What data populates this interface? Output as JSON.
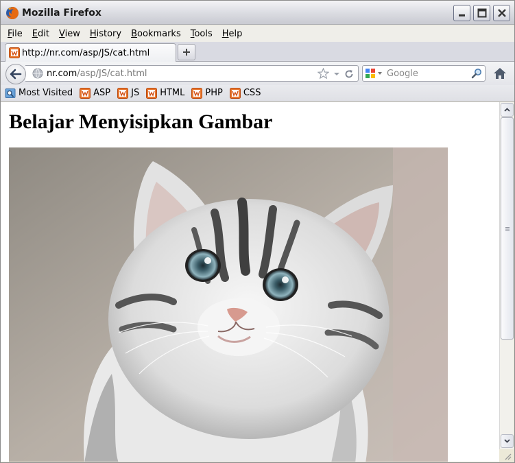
{
  "window": {
    "title": "Mozilla Firefox"
  },
  "menu": {
    "items": [
      {
        "label": "File",
        "key": "F",
        "rest": "ile"
      },
      {
        "label": "Edit",
        "key": "E",
        "rest": "dit"
      },
      {
        "label": "View",
        "key": "V",
        "rest": "iew"
      },
      {
        "label": "History",
        "key": "H",
        "rest": "istory"
      },
      {
        "label": "Bookmarks",
        "key": "B",
        "rest": "ookmarks"
      },
      {
        "label": "Tools",
        "key": "T",
        "rest": "ools"
      },
      {
        "label": "Help",
        "key": "H",
        "rest": "elp"
      }
    ]
  },
  "tab": {
    "label": "http://nr.com/asp/JS/cat.html"
  },
  "urlbar": {
    "domain": "nr.com",
    "path": "/asp/JS/cat.html"
  },
  "search": {
    "placeholder": "Google"
  },
  "bookmarks": [
    {
      "label": "Most Visited",
      "icon": "most-visited-icon"
    },
    {
      "label": "ASP",
      "icon": "w3-icon"
    },
    {
      "label": "JS",
      "icon": "w3-icon"
    },
    {
      "label": "HTML",
      "icon": "w3-icon"
    },
    {
      "label": "PHP",
      "icon": "w3-icon"
    },
    {
      "label": "CSS",
      "icon": "w3-icon"
    }
  ],
  "page": {
    "heading": "Belajar Menyisipkan Gambar"
  },
  "colors": {
    "accent_orange": "#e2571e",
    "w3_orange": "#d6671e"
  }
}
